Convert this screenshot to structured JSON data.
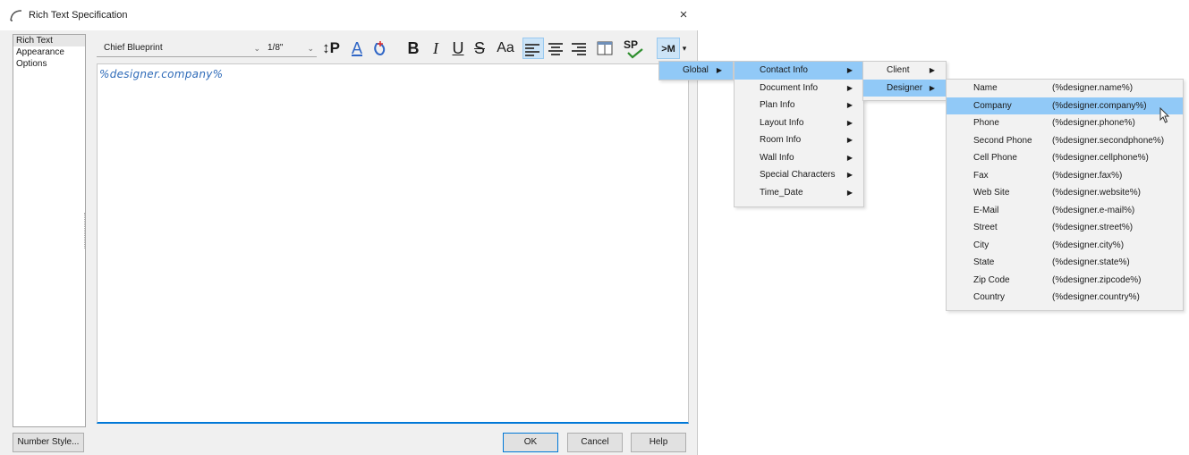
{
  "window": {
    "title": "Rich Text Specification",
    "close_glyph": "×",
    "title_icon": "arc-icon"
  },
  "sidebar": {
    "items": [
      {
        "label": "Rich Text",
        "active": true
      },
      {
        "label": "Appearance",
        "active": false
      },
      {
        "label": "Options",
        "active": false
      }
    ]
  },
  "toolbar": {
    "font": "Chief Blueprint",
    "size": "1/8\"",
    "chevron": "⌄",
    "line_spacing_glyph": "↕P",
    "font_color_glyph": "A",
    "bold": "B",
    "italic": "I",
    "underline": "U",
    "strikethrough": "S",
    "case_glyph": "Aa",
    "spell_glyph": "SP",
    "macro_glyph": ">M",
    "accent_color": "#0078d7",
    "font_color_bar": "#2f66c6"
  },
  "editor": {
    "text": "%designer.company%",
    "text_color": "#2d6ab8"
  },
  "buttons": {
    "number_style": "Number Style...",
    "ok": "OK",
    "cancel": "Cancel",
    "help": "Help"
  },
  "menus": {
    "level1": [
      {
        "label": "Global",
        "highlighted": true,
        "submenu": true
      }
    ],
    "level2": [
      {
        "label": "Contact Info",
        "highlighted": true,
        "submenu": true
      },
      {
        "label": "Document Info",
        "highlighted": false,
        "submenu": true
      },
      {
        "label": "Plan Info",
        "highlighted": false,
        "submenu": true
      },
      {
        "label": "Layout Info",
        "highlighted": false,
        "submenu": true
      },
      {
        "label": "Room Info",
        "highlighted": false,
        "submenu": true
      },
      {
        "label": "Wall Info",
        "highlighted": false,
        "submenu": true
      },
      {
        "label": "Special Characters",
        "highlighted": false,
        "submenu": true
      },
      {
        "label": "Time_Date",
        "highlighted": false,
        "submenu": true
      }
    ],
    "level3": [
      {
        "label": "Client",
        "highlighted": false,
        "submenu": true
      },
      {
        "label": "Designer",
        "highlighted": true,
        "submenu": true
      }
    ],
    "level4": [
      {
        "label": "Name",
        "value": "(%designer.name%)",
        "highlighted": false
      },
      {
        "label": "Company",
        "value": "(%designer.company%)",
        "highlighted": true
      },
      {
        "label": "Phone",
        "value": "(%designer.phone%)",
        "highlighted": false
      },
      {
        "label": "Second Phone",
        "value": "(%designer.secondphone%)",
        "highlighted": false
      },
      {
        "label": "Cell Phone",
        "value": "(%designer.cellphone%)",
        "highlighted": false
      },
      {
        "label": "Fax",
        "value": "(%designer.fax%)",
        "highlighted": false
      },
      {
        "label": "Web Site",
        "value": "(%designer.website%)",
        "highlighted": false
      },
      {
        "label": "E-Mail",
        "value": "(%designer.e-mail%)",
        "highlighted": false
      },
      {
        "label": "Street",
        "value": "(%designer.street%)",
        "highlighted": false
      },
      {
        "label": "City",
        "value": "(%designer.city%)",
        "highlighted": false
      },
      {
        "label": "State",
        "value": "(%designer.state%)",
        "highlighted": false
      },
      {
        "label": "Zip Code",
        "value": "(%designer.zipcode%)",
        "highlighted": false
      },
      {
        "label": "Country",
        "value": "(%designer.country%)",
        "highlighted": false
      }
    ],
    "submenu_arrow": "▶",
    "highlight_color": "#91c9f7"
  }
}
